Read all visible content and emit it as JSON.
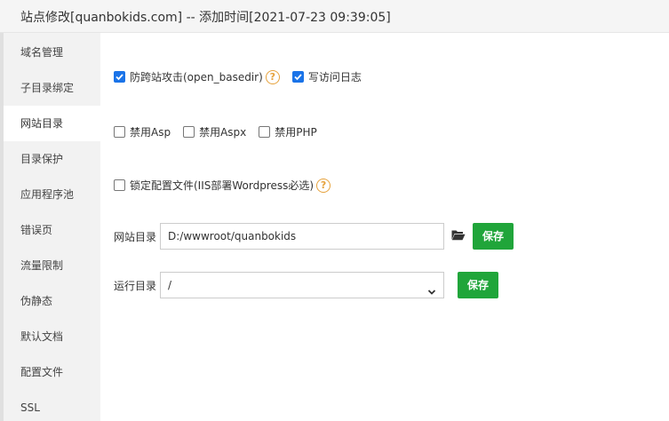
{
  "window": {
    "title": "站点修改[quanbokids.com] -- 添加时间[2021-07-23 09:39:05]"
  },
  "sidebar": {
    "items": [
      {
        "label": "域名管理"
      },
      {
        "label": "子目录绑定"
      },
      {
        "label": "网站目录"
      },
      {
        "label": "目录保护"
      },
      {
        "label": "应用程序池"
      },
      {
        "label": "错误页"
      },
      {
        "label": "流量限制"
      },
      {
        "label": "伪静态"
      },
      {
        "label": "默认文档"
      },
      {
        "label": "配置文件"
      },
      {
        "label": "SSL"
      }
    ],
    "active_index": 2
  },
  "options": {
    "open_basedir": {
      "label": "防跨站攻击(open_basedir)",
      "checked": true
    },
    "access_log": {
      "label": "写访问日志",
      "checked": true
    },
    "disable_asp": {
      "label": "禁用Asp",
      "checked": false
    },
    "disable_aspx": {
      "label": "禁用Aspx",
      "checked": false
    },
    "disable_php": {
      "label": "禁用PHP",
      "checked": false
    },
    "lock_config": {
      "label": "锁定配置文件(IIS部署Wordpress必选)",
      "checked": false
    },
    "help_glyph": "?"
  },
  "site_dir": {
    "label": "网站目录",
    "value": "D:/wwwroot/quanbokids",
    "icon": "folder-open-icon",
    "save_label": "保存"
  },
  "run_dir": {
    "label": "运行目录",
    "value": "/",
    "save_label": "保存"
  },
  "colors": {
    "primary_green": "#20a53a",
    "checkbox_blue": "#1a73e8",
    "help_orange": "#e6a23c"
  }
}
